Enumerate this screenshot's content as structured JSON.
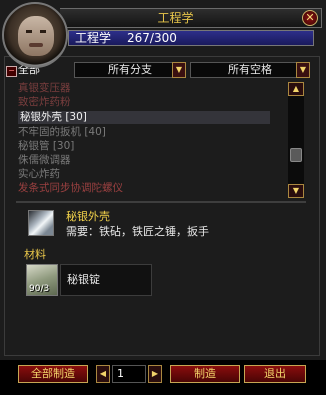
{
  "window": {
    "title": "工程学",
    "close_glyph": "✕"
  },
  "skill": {
    "name": "工程学",
    "value": "267/300",
    "progress": 0.89
  },
  "filters": {
    "collapse_glyph": "−",
    "all_label": "全部",
    "subclass": "所有分支",
    "slot": "所有空格"
  },
  "recipes": [
    {
      "label": "真银变压器",
      "state": "dim"
    },
    {
      "label": "致密炸药粉",
      "state": "dim"
    },
    {
      "label": "秘银外壳 [30]",
      "state": "selected"
    },
    {
      "label": "不牢固的扳机 [40]",
      "state": "gray"
    },
    {
      "label": "秘银管 [30]",
      "state": "gray"
    },
    {
      "label": "侏儒微调器",
      "state": "gray"
    },
    {
      "label": "实心炸药",
      "state": "gray"
    },
    {
      "label": "发条式同步协调陀螺仪",
      "state": "red"
    }
  ],
  "detail": {
    "name": "秘银外壳",
    "requires": "需要：铁砧，铁匠之锤，扳手",
    "materials_label": "材料",
    "reagent": {
      "name": "秘银锭",
      "count": "90/3"
    }
  },
  "footer": {
    "create_all": "全部制造",
    "quantity": "1",
    "create": "制造",
    "exit": "退出"
  }
}
